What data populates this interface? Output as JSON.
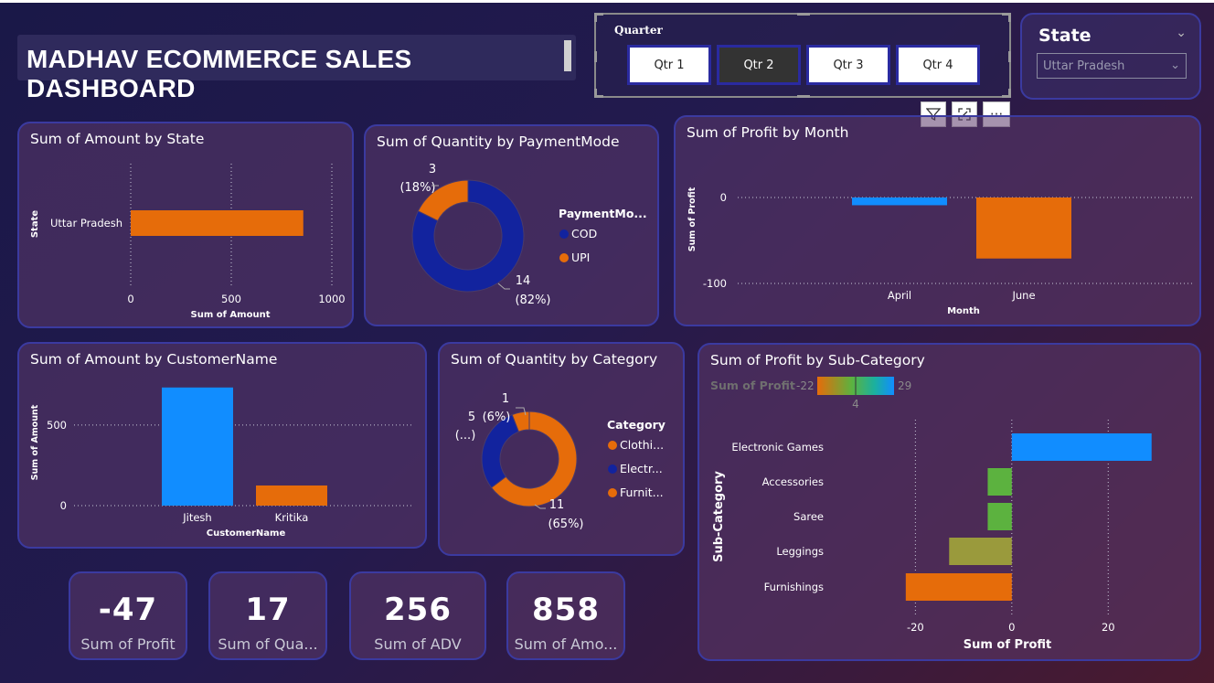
{
  "dashboard_title": "MADHAV ECOMMERCE SALES DASHBOARD",
  "quarter_slicer": {
    "label": "Quarter",
    "options": [
      "Qtr 1",
      "Qtr 2",
      "Qtr 3",
      "Qtr 4"
    ],
    "selected": "Qtr 2"
  },
  "state_slicer": {
    "label": "State",
    "selected": "Uttar Pradesh"
  },
  "visual_toolbar": {
    "icons": [
      "filter-icon",
      "focus-mode-icon",
      "more-options-icon"
    ],
    "more_label": "···"
  },
  "kpis": [
    {
      "value": "-47",
      "label": "Sum of Profit"
    },
    {
      "value": "17",
      "label": "Sum of Qua..."
    },
    {
      "value": "256",
      "label": "Sum of ADV"
    },
    {
      "value": "858",
      "label": "Sum of Amo..."
    }
  ],
  "titles": {
    "amount_by_state": "Sum of Amount by State",
    "qty_by_payment": "Sum of Quantity by PaymentMode",
    "profit_by_month": "Sum of Profit by Month",
    "amount_by_customer": "Sum of Amount by CustomerName",
    "qty_by_category": "Sum of Quantity by Category",
    "profit_by_subcat": "Sum of Profit by Sub-Category"
  },
  "colors": {
    "blue": "#118dff",
    "orange": "#e66c0a",
    "navy": "#12239e",
    "green": "#5cb23f",
    "olive": "#9a9a3c"
  },
  "chart_data": [
    {
      "id": "amount_by_state",
      "type": "bar",
      "orientation": "horizontal",
      "categories": [
        "Uttar Pradesh"
      ],
      "values": [
        858
      ],
      "xlabel": "Sum of Amount",
      "ylabel": "State",
      "xlim": [
        0,
        1000
      ],
      "xticks": [
        "0",
        "500",
        "1000"
      ]
    },
    {
      "id": "qty_by_payment",
      "type": "pie",
      "donut": true,
      "legend_title": "PaymentMo...",
      "slices": [
        {
          "label": "COD",
          "value": 14,
          "percent": "(82%)",
          "color": "#12239e"
        },
        {
          "label": "UPI",
          "value": 3,
          "percent": "(18%)",
          "color": "#e66c0a"
        }
      ]
    },
    {
      "id": "profit_by_month",
      "type": "bar",
      "categories": [
        "April",
        "June"
      ],
      "values": [
        -9,
        -71
      ],
      "xlabel": "Month",
      "ylabel": "Sum of Profit",
      "ylim": [
        -100,
        0
      ],
      "yticks": [
        "0",
        "-100"
      ],
      "colors": [
        "#118dff",
        "#e66c0a"
      ]
    },
    {
      "id": "amount_by_customer",
      "type": "bar",
      "categories": [
        "Jitesh",
        "Kritika"
      ],
      "values": [
        733,
        125
      ],
      "xlabel": "CustomerName",
      "ylabel": "Sum of Amount",
      "ylim": [
        0,
        800
      ],
      "yticks": [
        "0",
        "500"
      ],
      "colors": [
        "#118dff",
        "#e66c0a"
      ]
    },
    {
      "id": "qty_by_category",
      "type": "pie",
      "donut": true,
      "legend_title": "Category",
      "legend": [
        {
          "label": "Clothi...",
          "color": "#e66c0a"
        },
        {
          "label": "Electr...",
          "color": "#12239e"
        },
        {
          "label": "Furnit...",
          "color": "#e66c0a"
        }
      ],
      "slices": [
        {
          "value": 11,
          "percent": "(65%)",
          "color": "#e66c0a"
        },
        {
          "value": 5,
          "percent": "(...)",
          "color": "#12239e"
        },
        {
          "value": 1,
          "percent": "(6%)",
          "color": "#e66c0a"
        }
      ]
    },
    {
      "id": "profit_by_subcat",
      "type": "bar",
      "orientation": "horizontal",
      "categories": [
        "Electronic Games",
        "Accessories",
        "Saree",
        "Leggings",
        "Furnishings"
      ],
      "values": [
        29,
        -5,
        -5,
        -13,
        -22
      ],
      "xlabel": "Sum of Profit",
      "ylabel": "Sub-Category",
      "xlim": [
        -25,
        30
      ],
      "xticks": [
        "-20",
        "0",
        "20"
      ],
      "color_scale": {
        "label": "Sum of Profit",
        "min": "-22",
        "mid": "4",
        "max": "29"
      },
      "colors": [
        "#118dff",
        "#5cb23f",
        "#5cb23f",
        "#9a9a3c",
        "#e66c0a"
      ]
    }
  ]
}
